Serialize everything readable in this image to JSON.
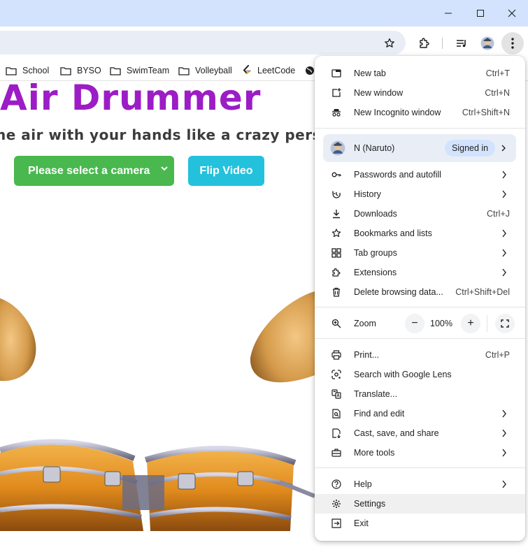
{
  "window": {
    "minimize_icon": "minimize-icon",
    "maximize_icon": "maximize-icon",
    "close_icon": "close-icon"
  },
  "toolbar": {
    "icons": [
      "star-icon",
      "extensions-icon",
      "media-control-icon",
      "avatar",
      "more-vert-icon"
    ]
  },
  "bookmarks": [
    {
      "label": "School",
      "icon": "folder-icon"
    },
    {
      "label": "BYSO",
      "icon": "folder-icon"
    },
    {
      "label": "SwimTeam",
      "icon": "folder-icon"
    },
    {
      "label": "Volleyball",
      "icon": "folder-icon"
    },
    {
      "label": "LeetCode",
      "icon": "leetcode-icon"
    },
    {
      "label": "",
      "icon": "globe-icon"
    }
  ],
  "page": {
    "title": "Air Drummer",
    "subtitle": "he air with your hands like a crazy perso",
    "camera_button": "Please select a camera",
    "flip_button": "Flip Video"
  },
  "menu": {
    "group1": [
      {
        "label": "New tab",
        "shortcut": "Ctrl+T",
        "icon": "new-tab-icon"
      },
      {
        "label": "New window",
        "shortcut": "Ctrl+N",
        "icon": "new-window-icon"
      },
      {
        "label": "New Incognito window",
        "shortcut": "Ctrl+Shift+N",
        "icon": "incognito-icon"
      }
    ],
    "profile": {
      "name": "N (Naruto)",
      "status": "Signed in"
    },
    "group2": [
      {
        "label": "Passwords and autofill",
        "icon": "key-icon"
      },
      {
        "label": "History",
        "icon": "history-icon"
      },
      {
        "label": "Downloads",
        "shortcut": "Ctrl+J",
        "icon": "download-icon"
      },
      {
        "label": "Bookmarks and lists",
        "icon": "star-icon"
      },
      {
        "label": "Tab groups",
        "icon": "tab-groups-icon"
      },
      {
        "label": "Extensions",
        "icon": "extensions-icon"
      },
      {
        "label": "Delete browsing data...",
        "shortcut": "Ctrl+Shift+Del",
        "icon": "trash-icon"
      }
    ],
    "zoom": {
      "label": "Zoom",
      "value": "100%",
      "minus": "−",
      "plus": "+"
    },
    "group3": [
      {
        "label": "Print...",
        "shortcut": "Ctrl+P",
        "icon": "print-icon"
      },
      {
        "label": "Search with Google Lens",
        "icon": "lens-icon"
      },
      {
        "label": "Translate...",
        "icon": "translate-icon"
      },
      {
        "label": "Find and edit",
        "icon": "find-icon"
      },
      {
        "label": "Cast, save, and share",
        "icon": "cast-icon"
      },
      {
        "label": "More tools",
        "icon": "toolbox-icon"
      }
    ],
    "group4": [
      {
        "label": "Help",
        "icon": "help-icon"
      },
      {
        "label": "Settings",
        "icon": "gear-icon"
      },
      {
        "label": "Exit",
        "icon": "exit-icon"
      }
    ]
  }
}
